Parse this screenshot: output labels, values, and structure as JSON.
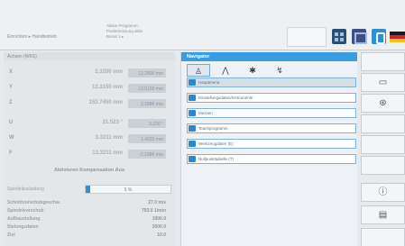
{
  "topbar": {
    "mode_label": "Einrichten ▸ Handbetrieb",
    "message_lines": [
      "Aktive Programm:",
      "Punktmessung aktiv",
      "Bereit 1 ▸"
    ],
    "icons": [
      "grid-icon",
      "panel-icon",
      "help-icon",
      "german-flag-icon"
    ]
  },
  "axes": {
    "header": "Achsen (WKS)",
    "rows": [
      {
        "name": "X",
        "value": "2.3200 mm",
        "dist": "12.2900 mm"
      },
      {
        "name": "Y",
        "value": "13.3150 mm",
        "dist": "13.5100 mm"
      },
      {
        "name": "Z",
        "value": "153.7450 mm",
        "dist": "2.1880 mm"
      },
      {
        "name": "U",
        "value": "21.523 °",
        "dist": "3.226 °"
      },
      {
        "name": "W",
        "value": "3.3211 mm",
        "dist": "1.4320 mm"
      },
      {
        "name": "F",
        "value": "13.3211 mm",
        "dist": "-2.1980 mm"
      }
    ],
    "compensation_label": "Aktivieren Kompensation Aus"
  },
  "feed": {
    "label": "Spindelauslastung",
    "value_text": "5 %",
    "fraction": 0.05
  },
  "info": [
    {
      "label": "Schnittvorschubgeschw.",
      "value": "27.0 m/s"
    },
    {
      "label": "Spindelvorschub",
      "value": "793.0 1/min"
    },
    {
      "label": "Aufbaustellung",
      "value": "1000.0"
    },
    {
      "label": "Stelungsdaten",
      "value": "2000.0"
    },
    {
      "label": "Ziel",
      "value": "10.0"
    }
  ],
  "navigator": {
    "title": "Navigator",
    "tabs": [
      {
        "name": "tab-user-icon",
        "glyph": "♙"
      },
      {
        "name": "tab-tool-icon",
        "glyph": "⋀"
      },
      {
        "name": "tab-gear-icon",
        "glyph": "✱"
      },
      {
        "name": "tab-wrench-icon",
        "glyph": "↯"
      }
    ],
    "items": [
      "Hauptmenü",
      "Einstellungsdaten/Instrumente",
      "Messen",
      "Teachprogramm",
      "Werkzeugdaten (E)",
      "Nullpunkttabelle (T)"
    ]
  },
  "softkeys": [
    {
      "glyph": ""
    },
    {
      "glyph": "▭"
    },
    {
      "glyph": "⊛"
    },
    {
      "glyph": ""
    },
    {
      "glyph": ""
    },
    {
      "glyph": ""
    },
    {
      "glyph": "ⓘ"
    },
    {
      "glyph": "▤"
    },
    {
      "glyph": ""
    }
  ]
}
